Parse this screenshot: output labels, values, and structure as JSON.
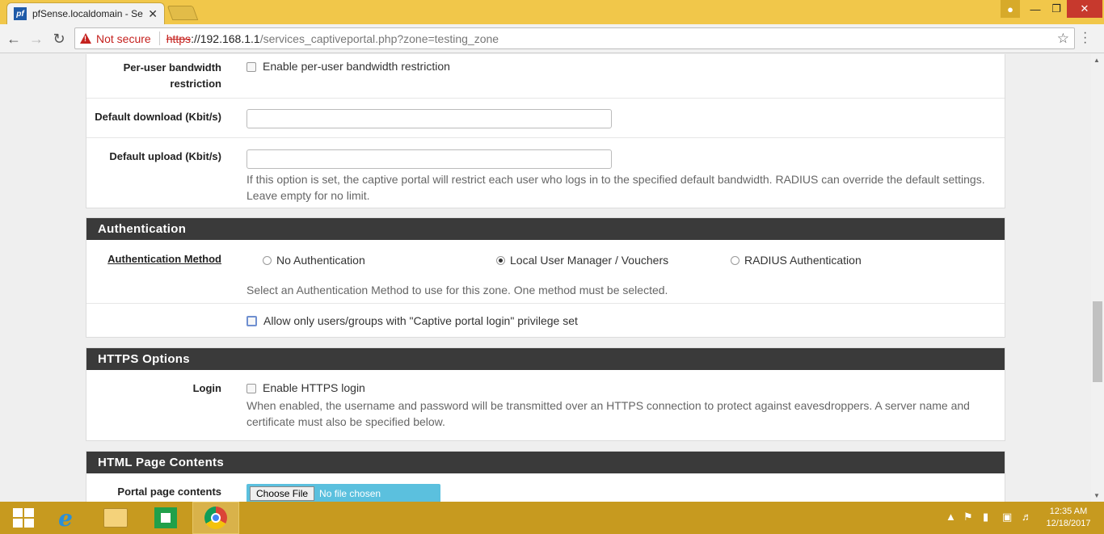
{
  "browser": {
    "tab_title": "pfSense.localdomain - Se",
    "tab_close": "✕",
    "favicon_text": "pf",
    "not_secure": "Not secure",
    "url_scheme": "https",
    "url_host": "://192.168.1.1",
    "url_path": "/services_captiveportal.php?zone=testing_zone"
  },
  "sections": {
    "bandwidth": {
      "per_user_label_1": "Per-user bandwidth",
      "per_user_label_2": "restriction",
      "per_user_checkbox": "Enable per-user bandwidth restriction",
      "download_label": "Default download (Kbit/s)",
      "download_value": "",
      "upload_label": "Default upload (Kbit/s)",
      "upload_value": "",
      "help_1": "If this option is set, the captive portal will restrict each user who logs in to the specified default bandwidth. RADIUS can override the default settings.",
      "help_2": "Leave empty for no limit."
    },
    "authentication": {
      "title": "Authentication",
      "method_label": "Authentication Method",
      "options": [
        "No Authentication",
        "Local User Manager / Vouchers",
        "RADIUS Authentication"
      ],
      "selected": "Local User Manager / Vouchers",
      "help": "Select an Authentication Method to use for this zone. One method must be selected.",
      "privilege_checkbox": "Allow only users/groups with \"Captive portal login\" privilege set"
    },
    "https": {
      "title": "HTTPS Options",
      "login_label": "Login",
      "login_checkbox": "Enable HTTPS login",
      "help_1": "When enabled, the username and password will be transmitted over an HTTPS connection to protect against eavesdroppers. A server name and",
      "help_2": "certificate must also be specified below."
    },
    "html": {
      "title": "HTML Page Contents",
      "portal_label": "Portal page contents",
      "file_button": "Choose File",
      "file_status": "No file chosen"
    }
  },
  "taskbar": {
    "time": "12:35 AM",
    "date": "12/18/2017"
  },
  "colors": {
    "tabstrip": "#f1c74a",
    "panel_header": "#3a3a3a",
    "taskbar": "#c79a1f",
    "file_input": "#5bc0de"
  }
}
